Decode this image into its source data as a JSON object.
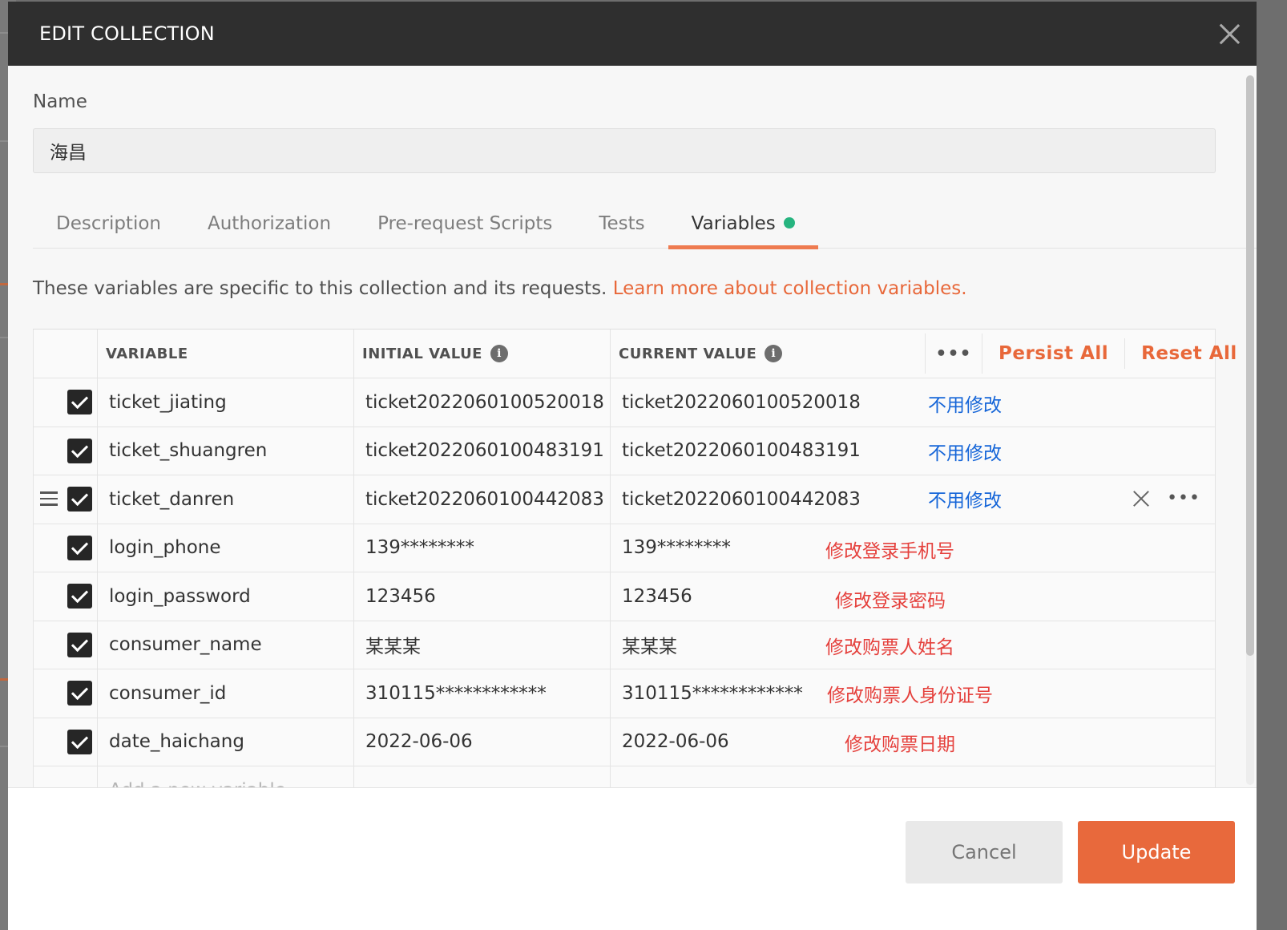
{
  "modal": {
    "title": "EDIT COLLECTION"
  },
  "name_field": {
    "label": "Name",
    "value": "海昌"
  },
  "tabs": [
    {
      "label": "Description"
    },
    {
      "label": "Authorization"
    },
    {
      "label": "Pre-request Scripts"
    },
    {
      "label": "Tests"
    },
    {
      "label": "Variables",
      "active": true,
      "status_color": "#26b47f"
    }
  ],
  "info": {
    "text": "These variables are specific to this collection and its requests.",
    "link": "Learn more about collection variables."
  },
  "table": {
    "headers": {
      "variable": "VARIABLE",
      "initial_value": "INITIAL VALUE",
      "current_value": "CURRENT VALUE",
      "info_glyph": "i",
      "more": "•••",
      "persist_all": "Persist All",
      "reset_all": "Reset All"
    },
    "rows": [
      {
        "checked": true,
        "variable": "ticket_jiating",
        "initial": "ticket2022060100520018",
        "current": "ticket2022060100520018",
        "note": "不用修改",
        "note_color": "blue"
      },
      {
        "checked": true,
        "variable": "ticket_shuangren",
        "initial": "ticket2022060100483191",
        "current": "ticket2022060100483191",
        "note": "不用修改",
        "note_color": "blue"
      },
      {
        "checked": true,
        "variable": "ticket_danren",
        "initial": "ticket2022060100442083",
        "current": "ticket2022060100442083",
        "note": "不用修改",
        "note_color": "blue",
        "hovered": true,
        "row_more": "•••"
      },
      {
        "checked": true,
        "variable": "login_phone",
        "initial": "139********",
        "current": "139********",
        "note": "修改登录手机号",
        "note_color": "red"
      },
      {
        "checked": true,
        "variable": "login_password",
        "initial": "123456",
        "current": "123456",
        "note": "修改登录密码",
        "note_color": "red"
      },
      {
        "checked": true,
        "variable": "consumer_name",
        "initial": "某某某",
        "current": "某某某",
        "note": "修改购票人姓名",
        "note_color": "red"
      },
      {
        "checked": true,
        "variable": "consumer_id",
        "initial": "310115************",
        "current": "310115************",
        "note": "修改购票人身份证号",
        "note_color": "red"
      },
      {
        "checked": true,
        "variable": "date_haichang",
        "initial": "2022-06-06",
        "current": "2022-06-06",
        "note": "修改购票日期",
        "note_color": "red"
      }
    ],
    "new_row_placeholder": "Add a new variable"
  },
  "footer": {
    "cancel": "Cancel",
    "update": "Update"
  },
  "colors": {
    "accent": "#e8693c",
    "header_bg": "#2f2f2f",
    "annotation_blue": "#1565d8",
    "annotation_red": "#e5413d"
  }
}
